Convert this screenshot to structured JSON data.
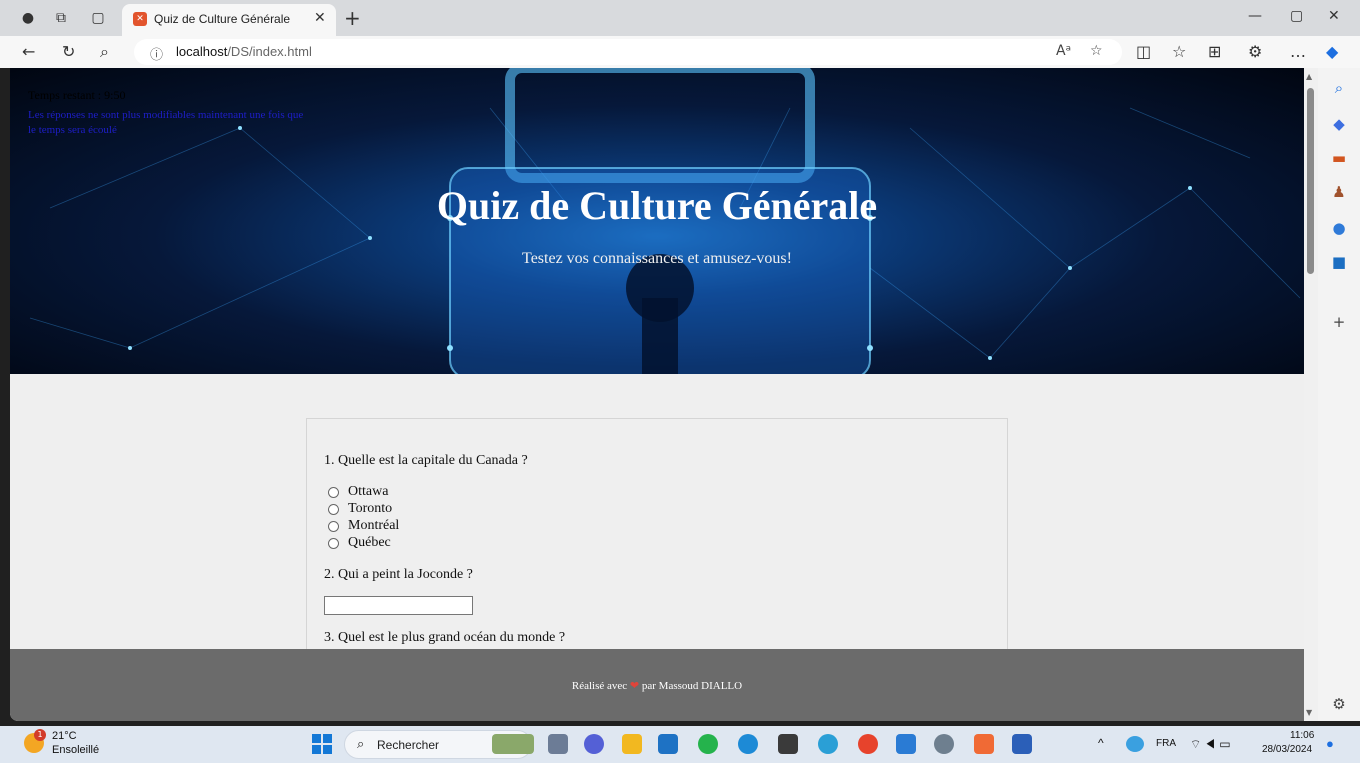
{
  "browser": {
    "tab_title": "Quiz de Culture Générale",
    "url_host": "localhost",
    "url_path": "/DS/index.html",
    "icons": [
      "profile-icon",
      "workspaces-icon",
      "tab-actions-icon",
      "close-icon",
      "new-tab-icon",
      "back-icon",
      "refresh-icon",
      "search-icon",
      "info-icon",
      "read-aloud-icon",
      "favorite-icon",
      "split-screen-icon",
      "favorites-icon",
      "collections-icon",
      "extensions-icon",
      "more-icon",
      "copilot-icon"
    ]
  },
  "hero": {
    "timer": "Temps restant : 9:50",
    "timer_note": "Les réponses ne sont plus modifiables maintenant une fois que le temps sera écoulé",
    "title": "Quiz de Culture Générale",
    "subtitle": "Testez vos connaissances et amusez-vous!"
  },
  "quiz": {
    "q1": "1. Quelle est la capitale du Canada ?",
    "q1_options": [
      "Ottawa",
      "Toronto",
      "Montréal",
      "Québec"
    ],
    "q2": "2. Qui a peint la Joconde ?",
    "q2_answer": "",
    "q3": "3. Quel est le plus grand océan du monde ?"
  },
  "footer": {
    "before": "Réalisé avec",
    "heart": "❤",
    "after": "par Massoud DIALLO"
  },
  "taskbar": {
    "temperature": "21°C",
    "weather": "Ensoleillé",
    "weather_badge": "1",
    "search_label": "Rechercher",
    "language": "FRA",
    "time": "11:06",
    "date": "28/03/2024"
  }
}
